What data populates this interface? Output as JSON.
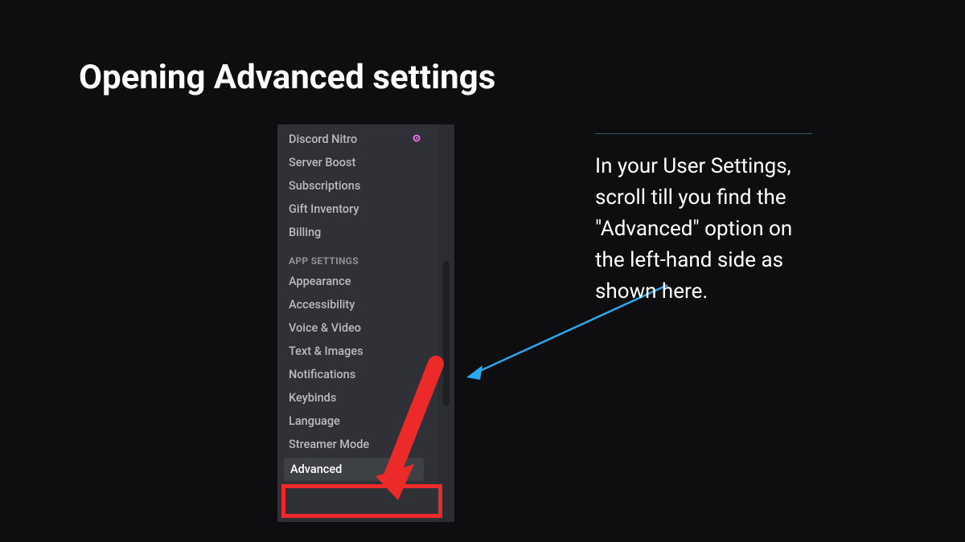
{
  "title": "Opening Advanced settings",
  "sidebar": {
    "billing_items": [
      "Discord Nitro",
      "Server Boost",
      "Subscriptions",
      "Gift Inventory",
      "Billing"
    ],
    "section_label": "APP SETTINGS",
    "app_items": [
      "Appearance",
      "Accessibility",
      "Voice & Video",
      "Text & Images",
      "Notifications",
      "Keybinds",
      "Language",
      "Streamer Mode",
      "Advanced"
    ],
    "selected": "Advanced"
  },
  "panel_text": "In your User Settings, scroll till you find the \"Advanced\" option on the left-hand side as shown here."
}
